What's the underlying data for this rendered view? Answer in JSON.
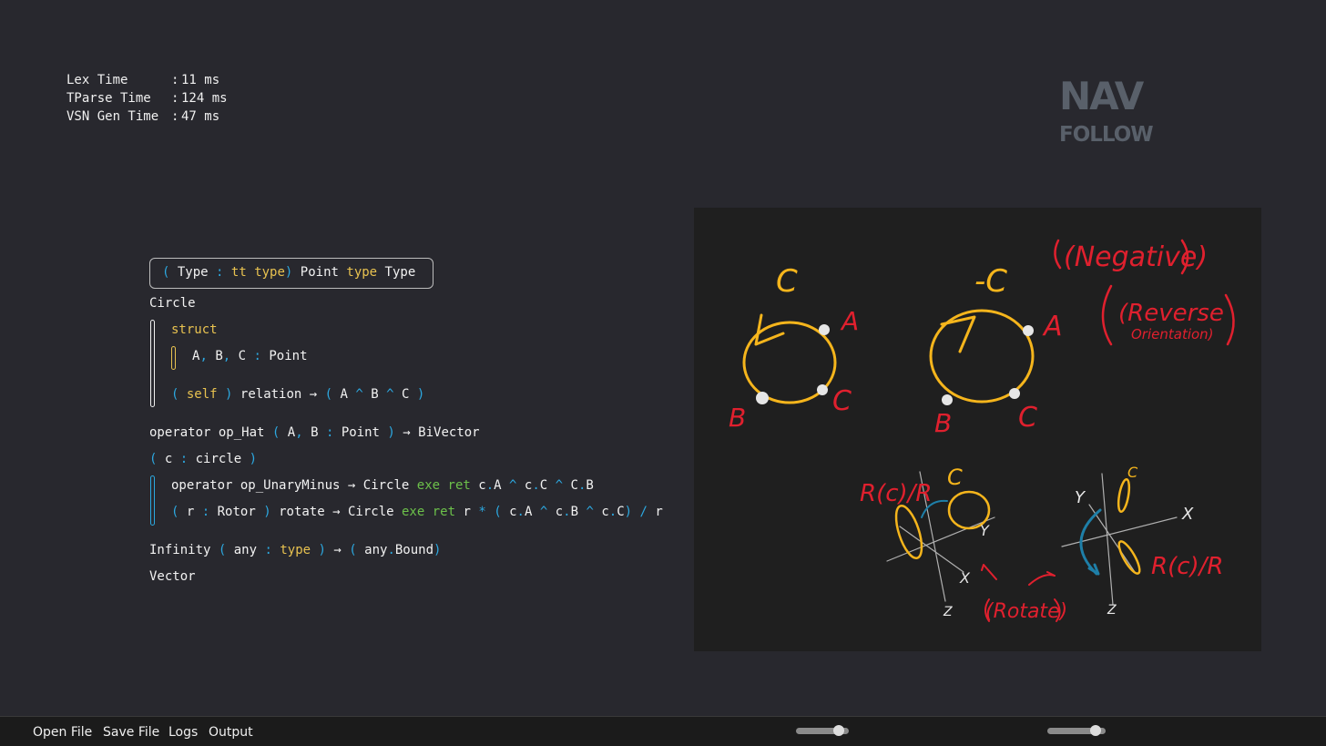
{
  "stats": [
    {
      "label": "Lex Time",
      "value": "11 ms"
    },
    {
      "label": "TParse Time",
      "value": "124 ms"
    },
    {
      "label": "VSN Gen Time",
      "value": "47 ms"
    }
  ],
  "stat_separator": ":",
  "nav": {
    "title": "NAV",
    "subtitle": "FOLLOW"
  },
  "code": {
    "type_decl": {
      "open": "(",
      "name": "Type",
      "colon": ":",
      "kw1": "tt",
      "kw2": "type",
      "close": ")",
      "point": "Point",
      "kw3": "type",
      "type": "Type"
    },
    "circle": "Circle",
    "struct_kw": "struct",
    "fields": {
      "a": "A",
      "comma1": ",",
      "b": "B",
      "comma2": ",",
      "c": "C",
      "colon": ":",
      "type": "Point"
    },
    "relation": {
      "open": "(",
      "self": "self",
      "close": ")",
      "name": "relation",
      "arrow": "→",
      "open2": "(",
      "a": "A",
      "hat1": "^",
      "b": "B",
      "hat2": "^",
      "c": "C",
      "close2": ")"
    },
    "op_hat": {
      "kw": "operator",
      "name": "op_Hat",
      "open": "(",
      "a": "A",
      "comma": ",",
      "b": "B",
      "colon": ":",
      "type": "Point",
      "close": ")",
      "arrow": "→",
      "ret": "BiVector"
    },
    "c_param": {
      "open": "(",
      "name": "c",
      "colon": ":",
      "type": "circle",
      "close": ")"
    },
    "op_unary": {
      "kw": "operator",
      "name": "op_UnaryMinus",
      "arrow": "→",
      "type": "Circle",
      "exe": "exe",
      "ret": "ret",
      "c1": "c",
      "d1": ".",
      "A": "A",
      "h1": "^",
      "c2": "c",
      "d2": ".",
      "C": "C",
      "h2": "^",
      "c3": "C",
      "d3": ".",
      "B": "B"
    },
    "rotate": {
      "open": "(",
      "r": "r",
      "colon": ":",
      "type": "Rotor",
      "close": ")",
      "name": "rotate",
      "arrow": "→",
      "ret_type": "Circle",
      "exe": "exe",
      "ret": "ret",
      "r2": "r",
      "star": "*",
      "open2": "(",
      "c1": "c",
      "d1": ".",
      "A": "A",
      "h1": "^",
      "c2": "c",
      "d2": ".",
      "B": "B",
      "h2": "^",
      "c3": "c",
      "d3": ".",
      "C": "C",
      "close2": ")",
      "slash": "/",
      "r3": "r"
    },
    "infinity": {
      "name": "Infinity",
      "open": "(",
      "any": "any",
      "colon": ":",
      "type": "type",
      "close": ")",
      "arrow": "→",
      "open2": "(",
      "any2": "any",
      "dot": ".",
      "bound": "Bound",
      "close2": ")"
    },
    "vector": "Vector"
  },
  "sketch": {
    "labels": {
      "c_top": "C",
      "minus_c": "-C",
      "negative": "(Negative)",
      "reverse": "(Reverse",
      "orientation": "Orientation)",
      "a1": "A",
      "b1": "B",
      "c1": "C",
      "a2": "A",
      "b2": "B",
      "c2": "C",
      "rcr1": "R(c)/R",
      "rcr2": "R(c)/R",
      "c3": "C",
      "c4": "C",
      "y1": "Y",
      "x1": "X",
      "z1": "Z",
      "y2": "Y",
      "x2": "X",
      "z2": "Z",
      "rotate": "(Rotate)"
    },
    "colors": {
      "yellow": "#f5b51c",
      "red": "#e0202e",
      "white": "#e6e6e6",
      "blue": "#1e7fa8",
      "gray": "#9a9a9a"
    }
  },
  "menu": {
    "open_file": "Open File",
    "save_file": "Save File",
    "logs": "Logs",
    "output": "Output"
  },
  "sliders": [
    {
      "value": 0.9
    },
    {
      "value": 0.9
    }
  ]
}
